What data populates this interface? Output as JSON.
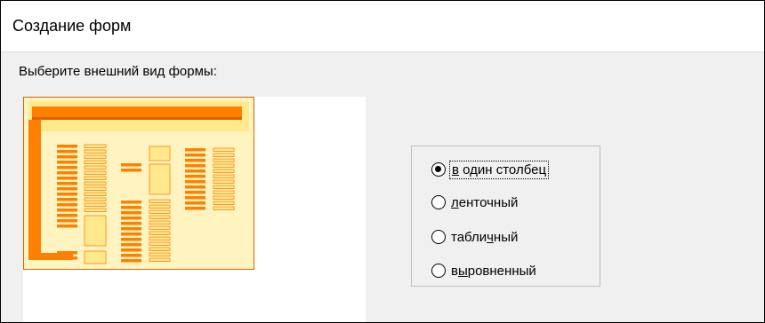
{
  "window": {
    "title": "Создание форм"
  },
  "prompt": "Выберите внешний вид формы:",
  "colors": {
    "preview_orange": "#ff8000",
    "preview_dark_orange": "#e06000",
    "preview_yellow": "#ffe98c",
    "preview_light_yellow": "#fff4c0"
  },
  "layout_options": {
    "selected": "в один столбец",
    "items": [
      {
        "pre": "",
        "accel": "в",
        "post": " один столбец",
        "checked": true,
        "focused": true
      },
      {
        "pre": "",
        "accel": "л",
        "post": "енточный",
        "checked": false,
        "focused": false
      },
      {
        "pre": "табли",
        "accel": "ч",
        "post": "ный",
        "checked": false,
        "focused": false
      },
      {
        "pre": "в",
        "accel": "ы",
        "post": "ровненный",
        "checked": false,
        "focused": false
      }
    ]
  }
}
